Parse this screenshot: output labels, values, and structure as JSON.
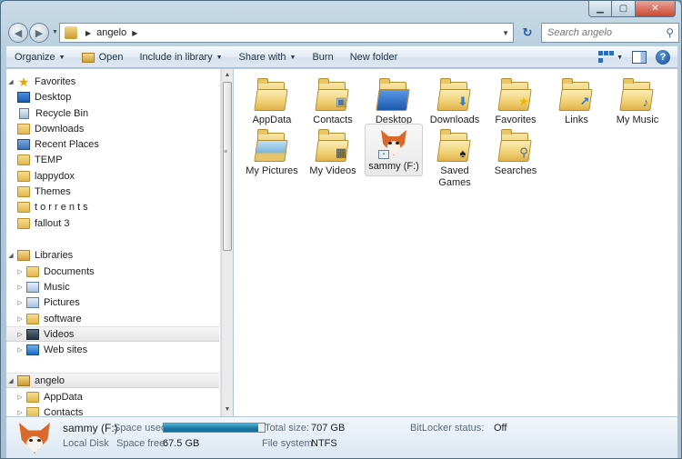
{
  "window": {
    "caption_min": "▁",
    "caption_max": "▢",
    "caption_close": "✕"
  },
  "address": {
    "crumbs": [
      "angelo"
    ],
    "search_placeholder": "Search angelo"
  },
  "commandbar": {
    "organize": "Organize",
    "open": "Open",
    "include_in_library": "Include in library",
    "share_with": "Share with",
    "burn": "Burn",
    "new_folder": "New folder"
  },
  "nav": {
    "favorites_header": "Favorites",
    "favorites": [
      "Desktop",
      "Recycle Bin",
      "Downloads",
      "Recent Places",
      "TEMP",
      "lappydox",
      "Themes",
      "t o r r e n t s",
      "fallout 3"
    ],
    "libraries_header": "Libraries",
    "libraries": [
      "Documents",
      "Music",
      "Pictures",
      "software",
      "Videos",
      "Web sites"
    ],
    "user_header": "angelo",
    "user_children": [
      "AppData",
      "Contacts"
    ]
  },
  "items": [
    {
      "label": "AppData",
      "icon": "folder-icon"
    },
    {
      "label": "Contacts",
      "icon": "contacts-folder-icon"
    },
    {
      "label": "Desktop",
      "icon": "desktop-folder-icon"
    },
    {
      "label": "Downloads",
      "icon": "downloads-folder-icon"
    },
    {
      "label": "Favorites",
      "icon": "favorites-folder-icon"
    },
    {
      "label": "Links",
      "icon": "links-folder-icon"
    },
    {
      "label": "My Music",
      "icon": "music-folder-icon"
    },
    {
      "label": "My Pictures",
      "icon": "pictures-folder-icon"
    },
    {
      "label": "My Videos",
      "icon": "videos-folder-icon"
    },
    {
      "label": "sammy (F:)",
      "icon": "fox-drive-icon"
    },
    {
      "label": "Saved Games",
      "icon": "saved-games-folder-icon"
    },
    {
      "label": "Searches",
      "icon": "searches-folder-icon"
    }
  ],
  "details": {
    "name": "sammy (F:)",
    "type": "Local Disk",
    "space_used_label": "Space used:",
    "space_used_fraction": 0.94,
    "space_free_label": "Space free:",
    "space_free_value": "67.5 GB",
    "total_size_label": "Total size:",
    "total_size_value": "707 GB",
    "file_system_label": "File system:",
    "file_system_value": "NTFS",
    "bitlocker_label": "BitLocker status:",
    "bitlocker_value": "Off"
  },
  "colors": {
    "selection": "#e6e6e6",
    "bar_fill": "#1f7fa9"
  }
}
